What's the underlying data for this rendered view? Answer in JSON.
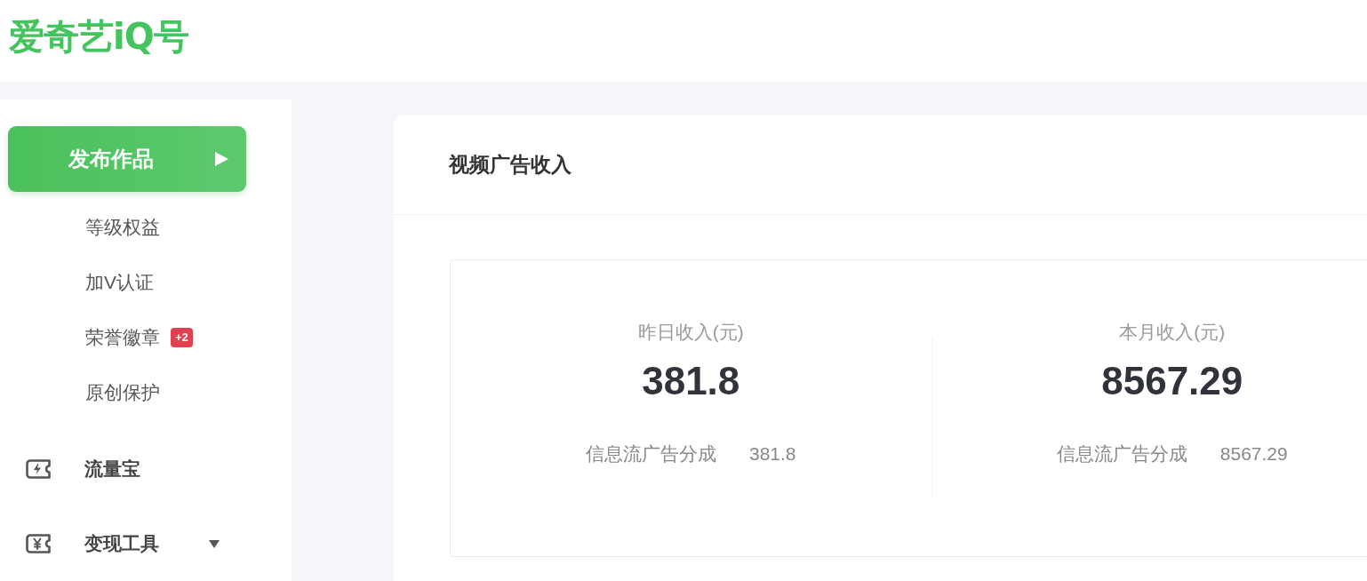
{
  "header": {
    "logo": "爱奇艺iQ号"
  },
  "sidebar": {
    "publish_button": {
      "label": "发布作品"
    },
    "items": [
      {
        "kind": "sub",
        "label": "等级权益"
      },
      {
        "kind": "sub",
        "label": "加V认证"
      },
      {
        "kind": "sub",
        "label": "荣誉徽章",
        "badge": "+2"
      },
      {
        "kind": "sub",
        "label": "原创保护"
      },
      {
        "kind": "link",
        "label": "流量宝"
      },
      {
        "kind": "dropdown",
        "label": "变现工具"
      }
    ]
  },
  "income_panel": {
    "title": "视频广告收入",
    "stats": [
      {
        "label": "昨日收入(元)",
        "value": "381.8",
        "detail_label": "信息流广告分成",
        "detail_value": "381.8"
      },
      {
        "label": "本月收入(元)",
        "value": "8567.29",
        "detail_label": "信息流广告分成",
        "detail_value": "8567.29"
      }
    ]
  }
}
